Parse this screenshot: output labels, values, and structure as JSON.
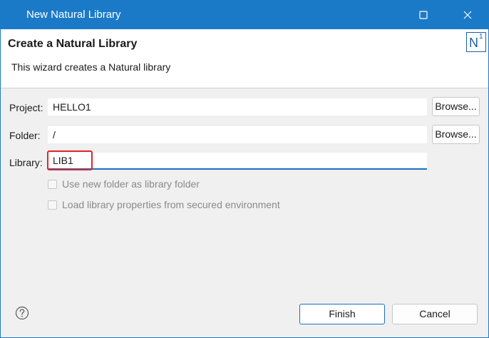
{
  "window": {
    "title": "New Natural Library"
  },
  "banner": {
    "title": "Create a Natural Library",
    "description": "This wizard creates a Natural library",
    "logo_letter": "N",
    "logo_superscript": "1"
  },
  "form": {
    "project_label": "Project:",
    "project_value": "HELLO1",
    "folder_label": "Folder:",
    "folder_value": "/",
    "library_label": "Library:",
    "library_value": "LIB1",
    "browse_label": "Browse...",
    "checkbox_new_folder": "Use new folder as library folder",
    "checkbox_secured": "Load library properties from secured environment"
  },
  "footer": {
    "finish_label": "Finish",
    "cancel_label": "Cancel"
  },
  "colors": {
    "accent": "#1b7ac7",
    "highlight": "#e3242b"
  },
  "icons": {
    "maximize": "maximize-icon",
    "close": "close-icon",
    "help": "help-icon"
  }
}
